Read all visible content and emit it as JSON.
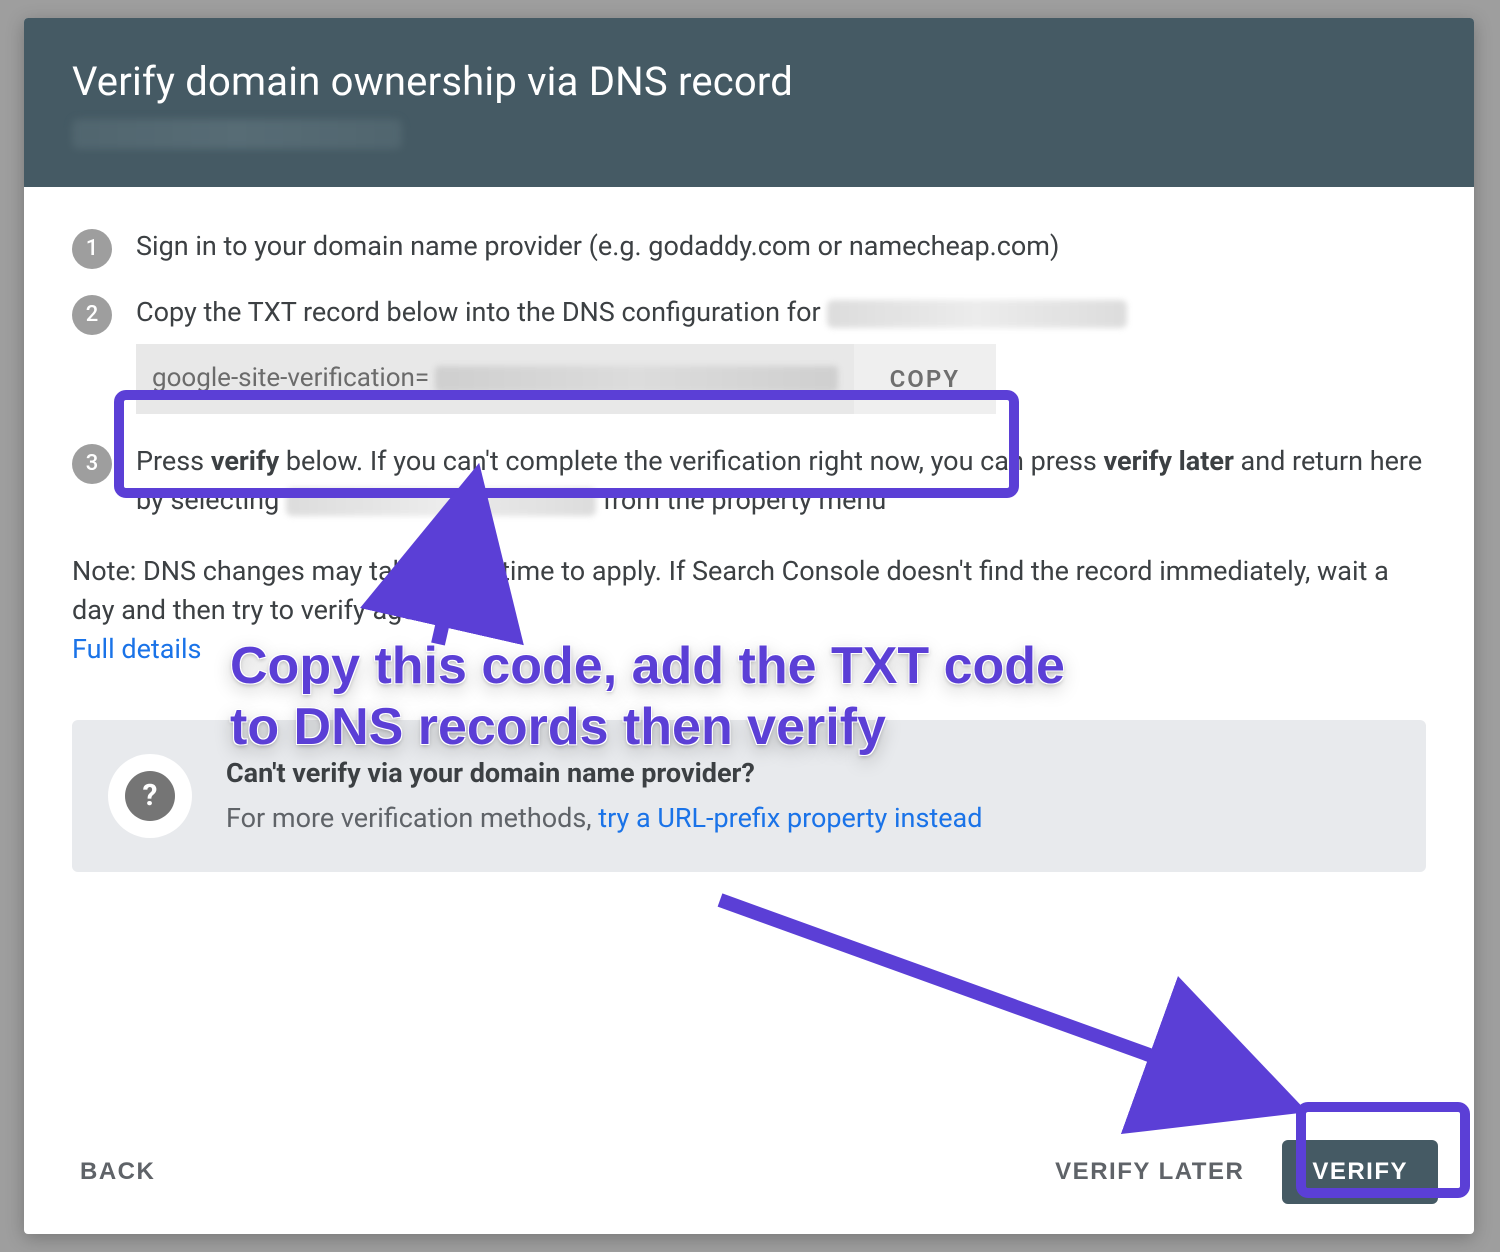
{
  "header": {
    "title": "Verify domain ownership via DNS record"
  },
  "steps": {
    "s1": {
      "num": "1",
      "text": "Sign in to your domain name provider (e.g. godaddy.com or namecheap.com)"
    },
    "s2": {
      "num": "2",
      "text_prefix": "Copy the TXT record below into the DNS configuration for ",
      "record_prefix": "google-site-verification=",
      "copy_label": "COPY"
    },
    "s3": {
      "num": "3",
      "pre": "Press ",
      "verify_word": "verify",
      "mid1": " below. If you can't complete the verification right now, you can press ",
      "verify_later_word": "verify later",
      "mid2": " and return here by selecting ",
      "post": " from the property menu"
    }
  },
  "note": {
    "line1": "Note: DNS changes may take some time to apply. If Search Console doesn't find the record immediately, wait a day and then try to verify again",
    "link": "Full details"
  },
  "help": {
    "title": "Can't verify via your domain name provider?",
    "sub_prefix": "For more verification methods, ",
    "sub_link": "try a URL-prefix property instead"
  },
  "actions": {
    "back": "BACK",
    "verify_later": "VERIFY LATER",
    "verify": "VERIFY"
  },
  "annotation": {
    "text": "Copy this code, add the TXT code to DNS records then verify"
  }
}
